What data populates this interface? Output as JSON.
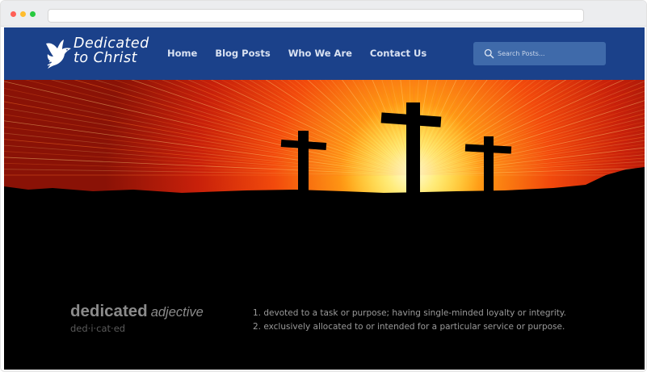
{
  "site": {
    "logo": {
      "line1": "Dedicated",
      "line2": "to Christ"
    },
    "nav": [
      {
        "label": "Home"
      },
      {
        "label": "Blog Posts"
      },
      {
        "label": "Who We Are"
      },
      {
        "label": "Contact Us"
      }
    ],
    "search": {
      "placeholder": "Search Posts..."
    }
  },
  "hero": {
    "icons": [
      "dove-icon",
      "cross-icon",
      "search-icon"
    ],
    "colors": {
      "nav_bg": "#1b418a",
      "search_bg": "#3f6aaa",
      "sky_core": "#ffe23a",
      "sky_edge": "#9e1606"
    }
  },
  "definition": {
    "term": "dedicated",
    "part_of_speech": "adjective",
    "syllables": "ded·i·cat·ed",
    "senses": [
      "1. devoted to a task or purpose; having single-minded loyalty or integrity.",
      "2. exclusively allocated to or intended for a particular service or purpose."
    ]
  }
}
